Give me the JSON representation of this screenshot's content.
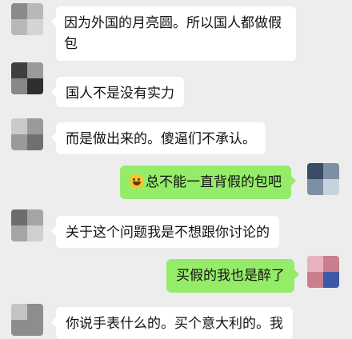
{
  "conversation": {
    "messages": [
      {
        "side": "left",
        "text": "因为外国的月亮圆。所以国人都做假包"
      },
      {
        "side": "left",
        "text": "国人不是没有实力"
      },
      {
        "side": "left",
        "text": "而是做出来的。傻逼们不承认。"
      },
      {
        "side": "right",
        "emoji": "laughing-face-icon",
        "text": "总不能一直背假的包吧"
      },
      {
        "side": "left",
        "text": "关于这个问题我是不想跟你讨论的"
      },
      {
        "side": "right",
        "text": "买假的我也是醉了"
      },
      {
        "side": "left",
        "text": "你说手表什么的。买个意大利的。我"
      }
    ]
  },
  "colors": {
    "background": "#ededed",
    "incoming_bubble": "#ffffff",
    "outgoing_bubble": "#95ec69"
  }
}
